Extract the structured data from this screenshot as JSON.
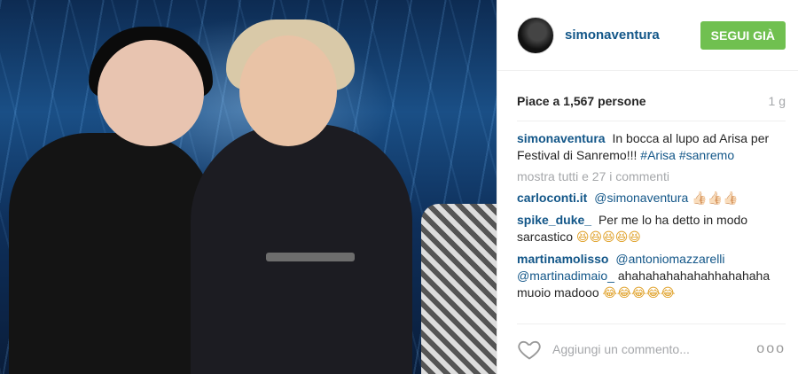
{
  "profile": {
    "username": "simonaventura",
    "follow_label": "SEGUI GIÀ"
  },
  "post": {
    "likes_text": "Piace a 1,567 persone",
    "age": "1 g",
    "caption_user": "simonaventura",
    "caption_text": "In bocca al lupo ad Arisa per Festival di Sanremo!!!",
    "caption_tags": "#Arisa #sanremo",
    "show_all_comments": "mostra tutti e 27 i commenti"
  },
  "comments": [
    {
      "user": "carloconti.it",
      "mention": "@simonaventura",
      "text": "",
      "emoji": "👍🏻👍🏻👍🏻"
    },
    {
      "user": "spike_duke_",
      "mention": "",
      "text": "Per me lo ha detto in modo sarcastico",
      "emoji": "😆😆😆😆😆"
    },
    {
      "user": "martinamolisso",
      "mention": "@antoniomazzarelli @martinadimaio_",
      "text": "ahahahahahahahhahahaha muoio madooo",
      "emoji": "😂😂😂😂😂"
    }
  ],
  "footer": {
    "comment_placeholder": "Aggiungi un commento...",
    "more_options": "ooo"
  },
  "colors": {
    "link": "#125688",
    "follow_bg": "#70c050",
    "muted": "#a5a7aa"
  }
}
